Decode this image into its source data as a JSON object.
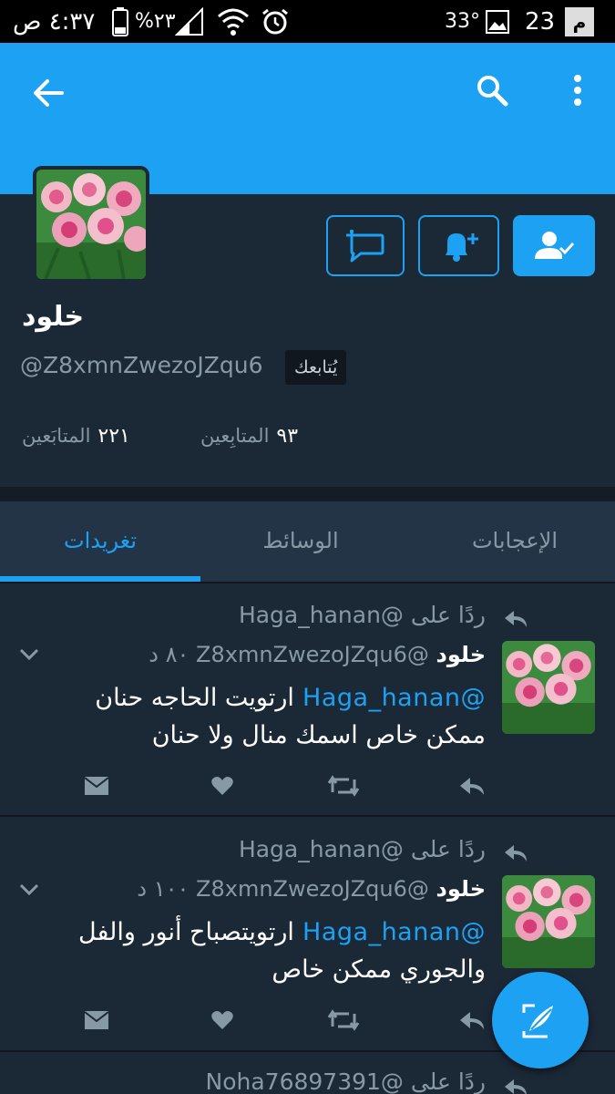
{
  "status_bar": {
    "time": "٤:٣٧ ص",
    "battery": "%٢٣",
    "temperature": "33°",
    "notification_count": "23"
  },
  "header": {
    "back_icon": "arrow-left-icon",
    "search_icon": "search-icon",
    "menu_icon": "more-vert-icon"
  },
  "profile": {
    "name": "خلود",
    "handle": "@Z8xmnZwezoJZqu6",
    "follows_you": "يُتابعك",
    "following_count": "٩٣",
    "following_label": "المتابِعين",
    "followers_count": "٢٢١",
    "followers_label": "المتابَعين",
    "actions": {
      "message_icon": "message-add-icon",
      "notify_icon": "bell-plus-icon",
      "following_icon": "person-check-icon"
    }
  },
  "tabs": [
    {
      "label": "تغريدات",
      "active": true
    },
    {
      "label": "الوسائط",
      "active": false
    },
    {
      "label": "الإعجابات",
      "active": false
    }
  ],
  "tweets": [
    {
      "reply_to": "ردًا على @Haga_hanan",
      "author_name": "خلود",
      "author_handle": "@Z8xmnZwezoJZqu6",
      "time": "٨٠ د",
      "mention": "@Haga_hanan",
      "text_line1": "ارتويت  الحاجه حنان",
      "text_line2": "ممكن خاص اسمك منال ولا حنان"
    },
    {
      "reply_to": "ردًا على @Haga_hanan",
      "author_name": "خلود",
      "author_handle": "@Z8xmnZwezoJZqu6",
      "time": "١٠٠ د",
      "mention": "@Haga_hanan",
      "text_line1": "ارتويتصباح أنور والفل",
      "text_line2": "والجوري ممكن خاص"
    },
    {
      "reply_to": "ردًا على @Noha76897391"
    }
  ],
  "colors": {
    "accent": "#1da1f2",
    "background": "#1b2836",
    "muted": "#8899a6"
  }
}
